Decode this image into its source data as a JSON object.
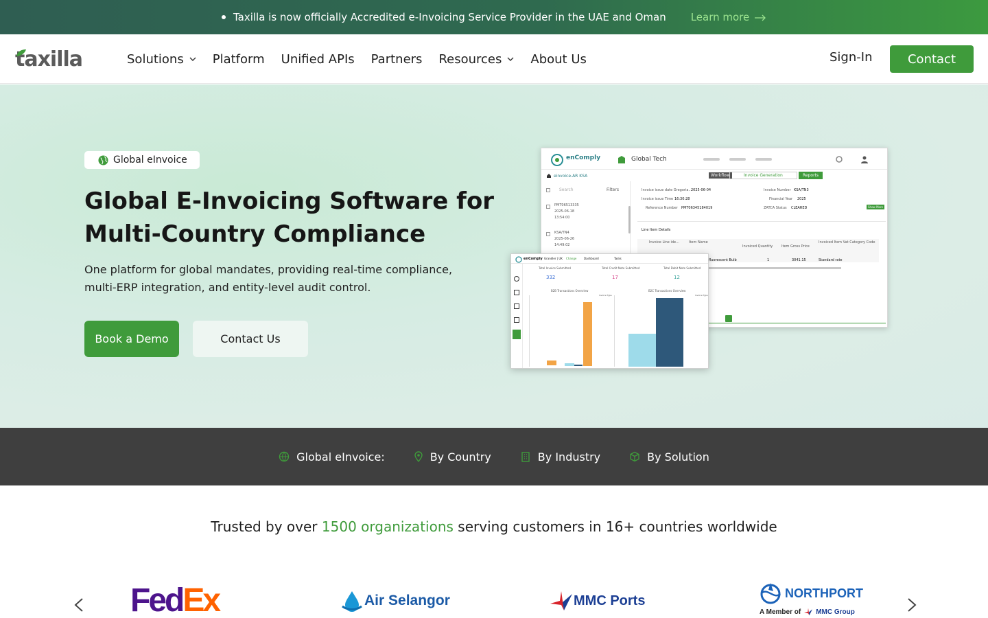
{
  "announcement": {
    "text": "Taxilla is now officially Accredited e-Invoicing Service Provider in the UAE and Oman",
    "link": "Learn more"
  },
  "header": {
    "logo": "taxilla",
    "nav": [
      {
        "label": "Solutions",
        "dropdown": true
      },
      {
        "label": "Platform",
        "dropdown": false
      },
      {
        "label": "Unified APIs",
        "dropdown": false
      },
      {
        "label": "Partners",
        "dropdown": false
      },
      {
        "label": "Resources",
        "dropdown": true
      },
      {
        "label": "About Us",
        "dropdown": false
      }
    ],
    "signin": "Sign-In",
    "contact": "Contact"
  },
  "hero": {
    "badge": "Global eInvoice",
    "title_line1": "Global E-Invoicing Software for",
    "title_line2": "Multi-Country Compliance",
    "subtitle_line1": "One platform for global mandates, providing real-time compliance,",
    "subtitle_line2": "multi-ERP integration, and entity-level audit control.",
    "cta_demo": "Book a Demo",
    "cta_contact": "Contact Us"
  },
  "mockup": {
    "app_name": "enComply",
    "org": "Global Tech",
    "breadcrumb": "einvoice-AR KSA",
    "workflow": "Workflow",
    "invoice_generation": "Invoice Generation",
    "reports": "Reports",
    "search": "Search",
    "filters": "Filters",
    "list_items": [
      {
        "id": "PMT06513335",
        "date": "2025-06-18",
        "time": "13:54:00"
      },
      {
        "id": "KSA/TN4",
        "date": "2025-06-26",
        "time": "14:49:02"
      }
    ],
    "fields": [
      {
        "label": "Invoice issue date Gregoria...",
        "value": "2025-06-04"
      },
      {
        "label": "Invoice issue Time",
        "value": "16:30:28"
      },
      {
        "label": "Reference Number",
        "value": "PMT06345184019"
      },
      {
        "label": "Invoice Number",
        "value": "KSA/TN3"
      },
      {
        "label": "Financial Year",
        "value": "2025"
      },
      {
        "label": "ZATCA Status",
        "value": "CLEARED"
      }
    ],
    "show_more": "Show More",
    "line_items_title": "Line Item Details",
    "line_columns": [
      "Invoice Line ide...",
      "Item Name",
      "Invoiced Quantity",
      "Item Gross Price",
      "Invoiced Item Vat Category Code"
    ],
    "line_row": [
      "fluorescent Bulb",
      "1",
      "3041.15",
      "Standard rate"
    ],
    "dash": {
      "app_name": "enComply",
      "org": "Grandler | UK",
      "change": "Change",
      "dashboard": "Dashboard",
      "tasks": "Tasks",
      "kpis": [
        {
          "label": "Total Invoice Submitted",
          "value": "332",
          "color": "#3b6fd4"
        },
        {
          "label": "Total Credit Note Submitted",
          "value": "17",
          "color": "#d6458a"
        },
        {
          "label": "Total Debit Note Submitted",
          "value": "12",
          "color": "#3aa39c"
        }
      ],
      "chart1_title": "B2B Transactions Overview",
      "chart2_title": "B2C Transactions Overview",
      "invoice_type": "Invoice Type"
    }
  },
  "categories": [
    {
      "label": "Global eInvoice:",
      "icon": "globe-icon"
    },
    {
      "label": "By Country",
      "icon": "location-pin-icon"
    },
    {
      "label": "By Industry",
      "icon": "building-icon"
    },
    {
      "label": "By Solution",
      "icon": "cube-icon"
    }
  ],
  "trusted": {
    "prefix": "Trusted by over ",
    "highlight": "1500 organizations",
    "suffix": " serving customers in 16+ countries worldwide"
  },
  "logos": {
    "fedex_a": "Fed",
    "fedex_b": "Ex",
    "air_selangor": "Air Selangor",
    "mmc_ports": "MMC Ports",
    "northport": "NORTHPORT",
    "northport_sub_a": "A Member of",
    "northport_sub_b": "MMC Group"
  },
  "colors": {
    "brand_green": "#3f9b3b",
    "dark_bar": "#3f3f3f",
    "fedex_purple": "#4d148c",
    "fedex_orange": "#ff6200"
  }
}
